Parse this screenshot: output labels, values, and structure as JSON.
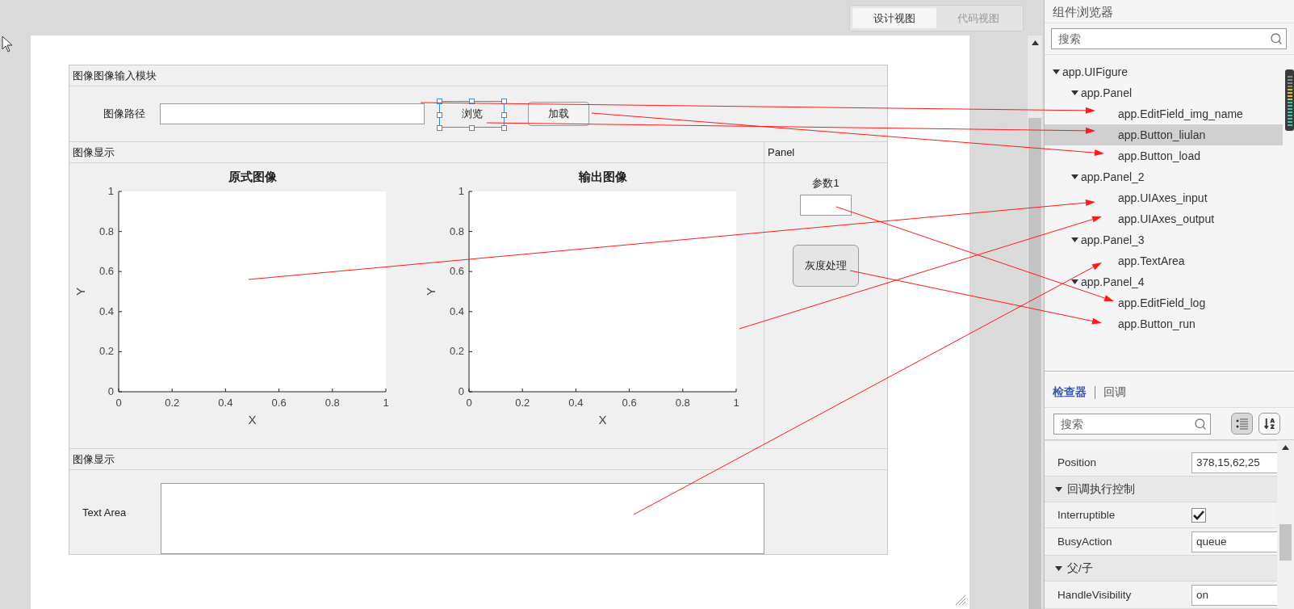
{
  "view_tabs": [
    {
      "label": "设计视图",
      "selected": true
    },
    {
      "label": "代码视图",
      "selected": false
    }
  ],
  "input_panel": {
    "title": "图像图像输入模块",
    "path_label": "图像路径",
    "browse_button": {
      "label": "浏览",
      "selected": true
    },
    "load_button": {
      "label": "加载",
      "selected": false
    }
  },
  "display_panel": {
    "title": "图像显示",
    "axes": [
      {
        "chart_data": {
          "type": "line",
          "title": "原式图像",
          "xlabel": "X",
          "ylabel": "Y",
          "xlim": [
            0,
            1
          ],
          "ylim": [
            0,
            1
          ],
          "xticks": [
            0,
            0.2,
            0.4,
            0.6,
            0.8,
            1
          ],
          "yticks": [
            0,
            0.2,
            0.4,
            0.6,
            0.8,
            1
          ]
        }
      },
      {
        "chart_data": {
          "type": "line",
          "title": "输出图像",
          "xlabel": "X",
          "ylabel": "Y",
          "xlim": [
            0,
            1
          ],
          "ylim": [
            0,
            1
          ],
          "xticks": [
            0,
            0.2,
            0.4,
            0.6,
            0.8,
            1
          ],
          "yticks": [
            0,
            0.2,
            0.4,
            0.6,
            0.8,
            1
          ]
        }
      }
    ]
  },
  "param_panel": {
    "title": "Panel",
    "param_label": "参数1",
    "run_button": "灰度处理"
  },
  "log_panel": {
    "title": "图像显示",
    "text_area_label": "Text Area"
  },
  "component_browser": {
    "title": "组件浏览器",
    "search": {
      "placeholder": "搜索"
    },
    "tree": [
      {
        "label": "app.UIFigure",
        "expanded": true,
        "selected": false,
        "children": [
          {
            "label": "app.Panel",
            "expanded": true,
            "selected": false,
            "children": [
              {
                "label": "app.EditField_img_name",
                "selected": false
              },
              {
                "label": "app.Button_liulan",
                "selected": true
              },
              {
                "label": "app.Button_load",
                "selected": false
              }
            ]
          },
          {
            "label": "app.Panel_2",
            "expanded": true,
            "selected": false,
            "children": [
              {
                "label": "app.UIAxes_input",
                "selected": false
              },
              {
                "label": "app.UIAxes_output",
                "selected": false
              }
            ]
          },
          {
            "label": "app.Panel_3",
            "expanded": true,
            "selected": false,
            "children": [
              {
                "label": "app.TextArea",
                "selected": false
              }
            ]
          },
          {
            "label": "app.Panel_4",
            "expanded": true,
            "selected": false,
            "children": [
              {
                "label": "app.EditField_log",
                "selected": false
              },
              {
                "label": "app.Button_run",
                "selected": false
              }
            ]
          }
        ]
      }
    ]
  },
  "inspector": {
    "tabs": [
      {
        "label": "检查器",
        "selected": true
      },
      {
        "label": "回调",
        "selected": false
      }
    ],
    "search": {
      "placeholder": "搜索"
    },
    "view_buttons": [
      {
        "kind": "grouped",
        "selected": true
      },
      {
        "kind": "alphabetical",
        "selected": false
      }
    ],
    "properties": [
      {
        "kind": "property",
        "name": "Position",
        "value": "378,15,62,25"
      },
      {
        "kind": "section",
        "label": "回调执行控制",
        "expanded": true
      },
      {
        "kind": "checkbox",
        "name": "Interruptible",
        "checked": true
      },
      {
        "kind": "property",
        "name": "BusyAction",
        "value": "queue"
      },
      {
        "kind": "section",
        "label": "父/子",
        "expanded": true
      },
      {
        "kind": "property",
        "name": "HandleVisibility",
        "value": "on"
      }
    ]
  }
}
